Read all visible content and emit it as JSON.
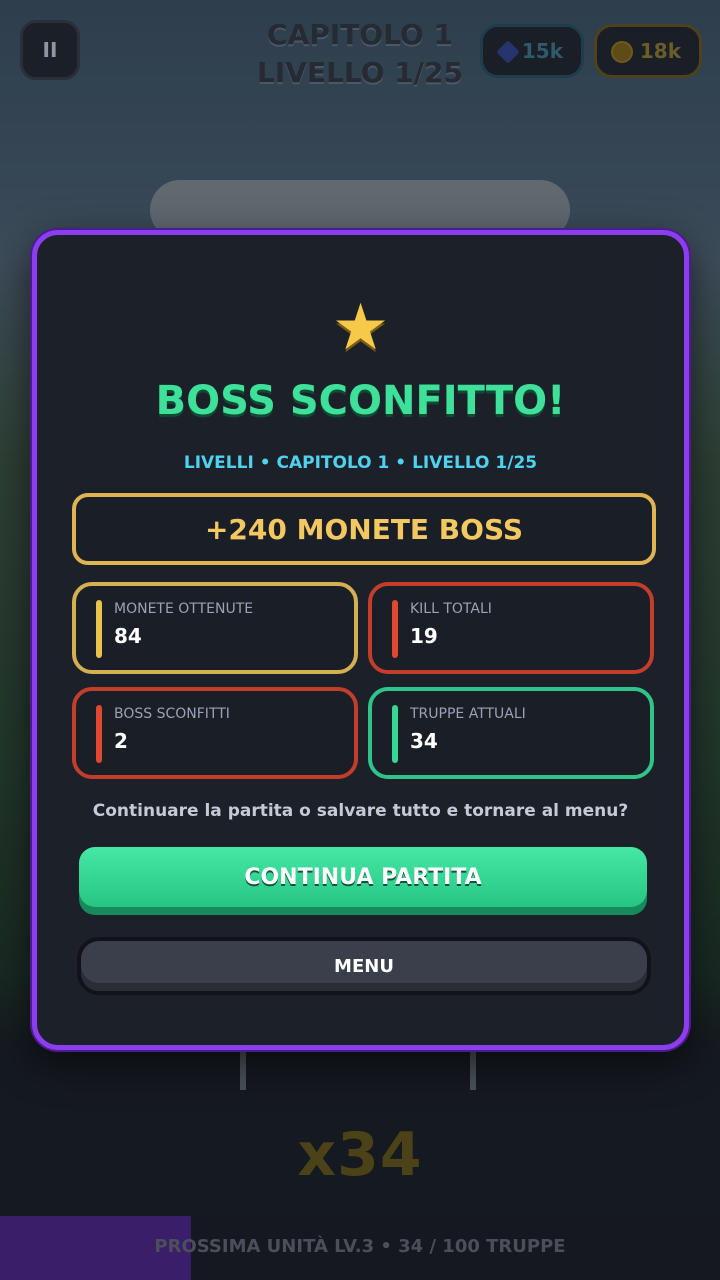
{
  "hud": {
    "pause_icon": "pause-icon",
    "pause_glyph": "II",
    "chapter_line1": "CAPITOLO 1",
    "chapter_line2": "LIVELLO 1/25",
    "gems": "15k",
    "coins": "18k"
  },
  "modal": {
    "star_glyph": "★",
    "title": "BOSS SCONFITTO!",
    "subtitle": "LIVELLI • CAPITOLO 1 • LIVELLO 1/25",
    "boss_reward": "+240 MONETE BOSS",
    "stats": [
      {
        "label": "MONETE OTTENUTE",
        "value": "84",
        "color": "#d4b052"
      },
      {
        "label": "KILL TOTALI",
        "value": "19",
        "color": "#c33e2a"
      },
      {
        "label": "BOSS SCONFITTI",
        "value": "2",
        "color": "#c33e2a"
      },
      {
        "label": "TRUPPE ATTUALI",
        "value": "34",
        "color": "#2fc58a"
      }
    ],
    "question": "Continuare la partita o salvare tutto e tornare al menu?",
    "continue_label": "CONTINUA PARTITA",
    "menu_label": "MENU"
  },
  "game": {
    "multiplier": "x34",
    "next_unit_text": "PROSSIMA UNITÀ LV.3 • 34 / 100 TRUPPE",
    "troop_progress": 0.34
  },
  "colors": {
    "accent_purple": "#8d3df0",
    "title_green": "#3ee09a",
    "subtitle_cyan": "#4fd2f0",
    "gold": "#f4c860"
  }
}
